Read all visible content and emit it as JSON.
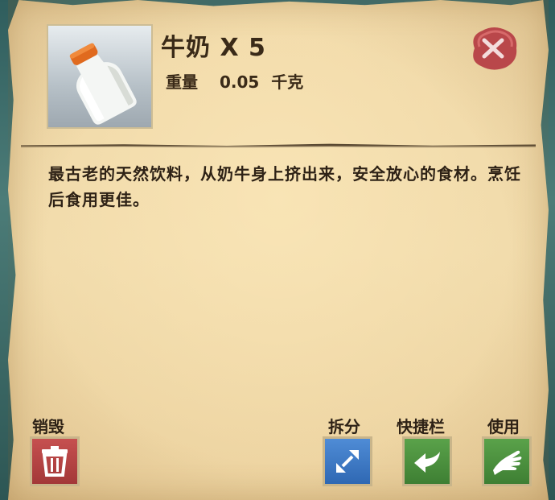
{
  "item": {
    "name": "牛奶",
    "quantity_text": "X 5",
    "weight_label": "重量",
    "weight_value": "0.05",
    "weight_unit": "千克",
    "icon": "milk-bottle-icon",
    "description": "最古老的天然饮料，从奶牛身上挤出来，安全放心的食材。烹饪后食用更佳。"
  },
  "close": {
    "icon": "close-icon"
  },
  "actions": {
    "destroy": {
      "label": "销毁",
      "icon": "trash-icon",
      "color": "#b54545"
    },
    "split": {
      "label": "拆分",
      "icon": "expand-arrows-icon",
      "color": "#3d7cc6"
    },
    "quickbar": {
      "label": "快捷栏",
      "icon": "arrow-left-icon",
      "color": "#4c9240"
    },
    "use": {
      "label": "使用",
      "icon": "hand-icon",
      "color": "#4c9240"
    }
  }
}
